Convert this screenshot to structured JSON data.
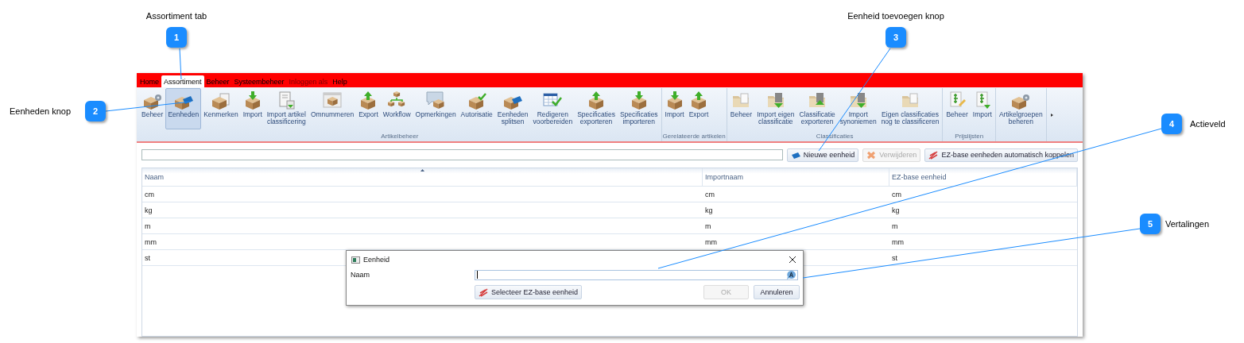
{
  "menu": [
    {
      "label": "Home",
      "selected": false,
      "disabled": false
    },
    {
      "label": "Assortiment",
      "selected": true,
      "disabled": false
    },
    {
      "label": "Beheer",
      "selected": false,
      "disabled": false
    },
    {
      "label": "Systeembeheer",
      "selected": false,
      "disabled": false
    },
    {
      "label": "Inloggen als",
      "selected": false,
      "disabled": true
    },
    {
      "label": "Help",
      "selected": false,
      "disabled": false
    }
  ],
  "ribbon": {
    "groups": [
      {
        "title": "Artikelbeheer",
        "buttons": [
          {
            "label": "Beheer",
            "selected": false
          },
          {
            "label": "Eenheden",
            "selected": true
          },
          {
            "label": "Kenmerken",
            "selected": false
          },
          {
            "label": "Import",
            "selected": false
          },
          {
            "label": "Import artikel\nclassificering",
            "selected": false
          },
          {
            "label": "Omnummeren",
            "selected": false
          },
          {
            "label": "Export",
            "selected": false
          },
          {
            "label": "Workflow",
            "selected": false
          },
          {
            "label": "Opmerkingen",
            "selected": false
          },
          {
            "label": "Autorisatie",
            "selected": false
          },
          {
            "label": "Eenheden\nsplitsen",
            "selected": false
          },
          {
            "label": "Redigeren\nvoorbereiden",
            "selected": false
          },
          {
            "label": "Specificaties\nexporteren",
            "selected": false
          },
          {
            "label": "Specificaties\nimporteren",
            "selected": false
          }
        ]
      },
      {
        "title": "Gerelateerde artikelen",
        "buttons": [
          {
            "label": "Import",
            "selected": false
          },
          {
            "label": "Export",
            "selected": false
          }
        ]
      },
      {
        "title": "Classificaties",
        "buttons": [
          {
            "label": "Beheer",
            "selected": false
          },
          {
            "label": "Import eigen\nclassificatie",
            "selected": false
          },
          {
            "label": "Classificatie\nexporteren",
            "selected": false
          },
          {
            "label": "Import\nsynoniemen",
            "selected": false
          },
          {
            "label": "Eigen classificaties\nnog te classificeren",
            "selected": false
          }
        ]
      },
      {
        "title": "Prijslijsten",
        "buttons": [
          {
            "label": "Beheer",
            "selected": false
          },
          {
            "label": "Import",
            "selected": false
          }
        ]
      },
      {
        "buttons": [
          {
            "label": "Artikelgroepen\nbeheren",
            "selected": false
          }
        ]
      }
    ]
  },
  "toolbar": {
    "buttons": [
      {
        "label": "Nieuwe eenheid",
        "disabled": false
      },
      {
        "label": "Verwijderen",
        "disabled": true
      },
      {
        "label": "EZ-base eenheden automatisch koppelen",
        "disabled": false
      }
    ]
  },
  "table": {
    "columns": [
      "Naam",
      "Importnaam",
      "EZ-base eenheid"
    ],
    "rows": [
      [
        "cm",
        "cm",
        "cm"
      ],
      [
        "kg",
        "kg",
        "kg"
      ],
      [
        "m",
        "m",
        "m"
      ],
      [
        "mm",
        "mm",
        "mm"
      ],
      [
        "st",
        null,
        "st"
      ]
    ]
  },
  "dialog": {
    "title": "Eenheid",
    "field_label": "Naam",
    "buttons": [
      {
        "label": "Selecteer EZ-base eenheid",
        "disabled": false
      },
      {
        "label": "OK",
        "disabled": true
      },
      {
        "label": "Annuleren",
        "disabled": false
      }
    ]
  },
  "callouts": [
    {
      "number": "1",
      "label": "Assortiment tab"
    },
    {
      "number": "2",
      "label": "Eenheden knop"
    },
    {
      "number": "3",
      "label": "Eenheid toevoegen knop"
    },
    {
      "number": "4",
      "label": "Actieveld"
    },
    {
      "number": "5",
      "label": "Vertalingen"
    }
  ]
}
